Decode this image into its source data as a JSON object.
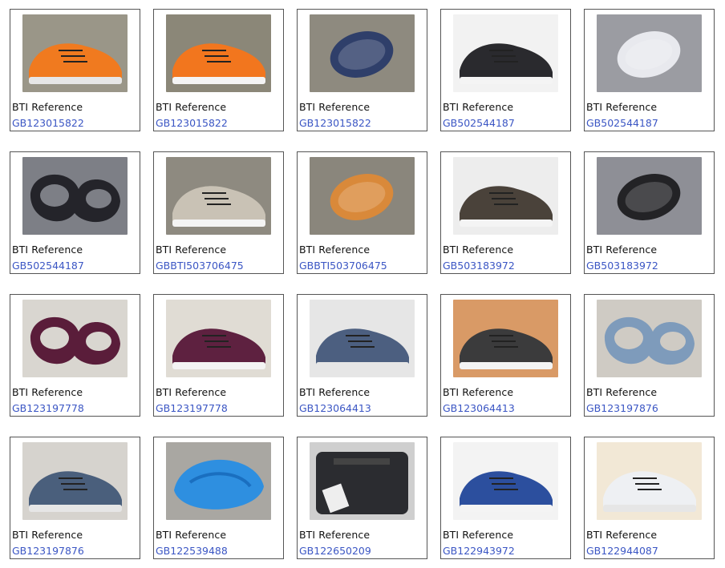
{
  "items": [
    {
      "label": "BTI Reference",
      "ref": "GB123015822",
      "image": "orange-sneaker-icon",
      "bg": "#9a9688",
      "main": "#f07a1f"
    },
    {
      "label": "BTI Reference",
      "ref": "GB123015822",
      "image": "orange-sneaker-side-icon",
      "bg": "#8b8778",
      "main": "#f2761e"
    },
    {
      "label": "BTI Reference",
      "ref": "GB123015822",
      "image": "sneaker-sole-icon",
      "bg": "#8e8a7f",
      "main": "#2f3f6a"
    },
    {
      "label": "BTI Reference",
      "ref": "GB502544187",
      "image": "black-white-sneaker-icon",
      "bg": "#f2f2f2",
      "main": "#2a2a2e"
    },
    {
      "label": "BTI Reference",
      "ref": "GB502544187",
      "image": "white-sole-icon",
      "bg": "#9b9ca2",
      "main": "#e8e9ee"
    },
    {
      "label": "BTI Reference",
      "ref": "GB502544187",
      "image": "black-shoe-top-icon",
      "bg": "#7d7f86",
      "main": "#24242a"
    },
    {
      "label": "BTI Reference",
      "ref": "GBBTI503706475",
      "image": "grey-knit-sneaker-icon",
      "bg": "#8e8a80",
      "main": "#c9c2b5"
    },
    {
      "label": "BTI Reference",
      "ref": "GBBTI503706475",
      "image": "orange-sole-icon",
      "bg": "#8a867c",
      "main": "#d9893a"
    },
    {
      "label": "BTI Reference",
      "ref": "GB503183972",
      "image": "mary-jane-shoe-icon",
      "bg": "#ededed",
      "main": "#4a423a"
    },
    {
      "label": "BTI Reference",
      "ref": "GB503183972",
      "image": "black-sole-icon",
      "bg": "#8e8f96",
      "main": "#232326"
    },
    {
      "label": "BTI Reference",
      "ref": "GB123197778",
      "image": "purple-flat-top-icon",
      "bg": "#d9d6d0",
      "main": "#5a1d3a"
    },
    {
      "label": "BTI Reference",
      "ref": "GB123197778",
      "image": "purple-flat-side-icon",
      "bg": "#e0dcd4",
      "main": "#5e2140"
    },
    {
      "label": "BTI Reference",
      "ref": "GB123064413",
      "image": "denim-sneaker-icon",
      "bg": "#e6e6e6",
      "main": "#4c5f80"
    },
    {
      "label": "BTI Reference",
      "ref": "GB123064413",
      "image": "baby-shoe-icon",
      "bg": "#d99a66",
      "main": "#3b3b3c"
    },
    {
      "label": "BTI Reference",
      "ref": "GB123197876",
      "image": "blue-flat-top-icon",
      "bg": "#cfcbc4",
      "main": "#7e9bbb"
    },
    {
      "label": "BTI Reference",
      "ref": "GB123197876",
      "image": "blue-leather-shoe-icon",
      "bg": "#d6d3ce",
      "main": "#4a5f7c"
    },
    {
      "label": "BTI Reference",
      "ref": "GB122539488",
      "image": "blue-shoe-cover-icon",
      "bg": "#a9a7a2",
      "main": "#2e8fe0"
    },
    {
      "label": "BTI Reference",
      "ref": "GB122650209",
      "image": "black-bag-icon",
      "bg": "#cfcfcf",
      "main": "#2b2c30"
    },
    {
      "label": "BTI Reference",
      "ref": "GB122943972",
      "image": "blue-platform-sneaker-icon",
      "bg": "#f3f3f3",
      "main": "#2c4f9e"
    },
    {
      "label": "BTI Reference",
      "ref": "GB122944087",
      "image": "white-platform-sneaker-icon",
      "bg": "#f2e8d6",
      "main": "#eef0f3"
    }
  ]
}
